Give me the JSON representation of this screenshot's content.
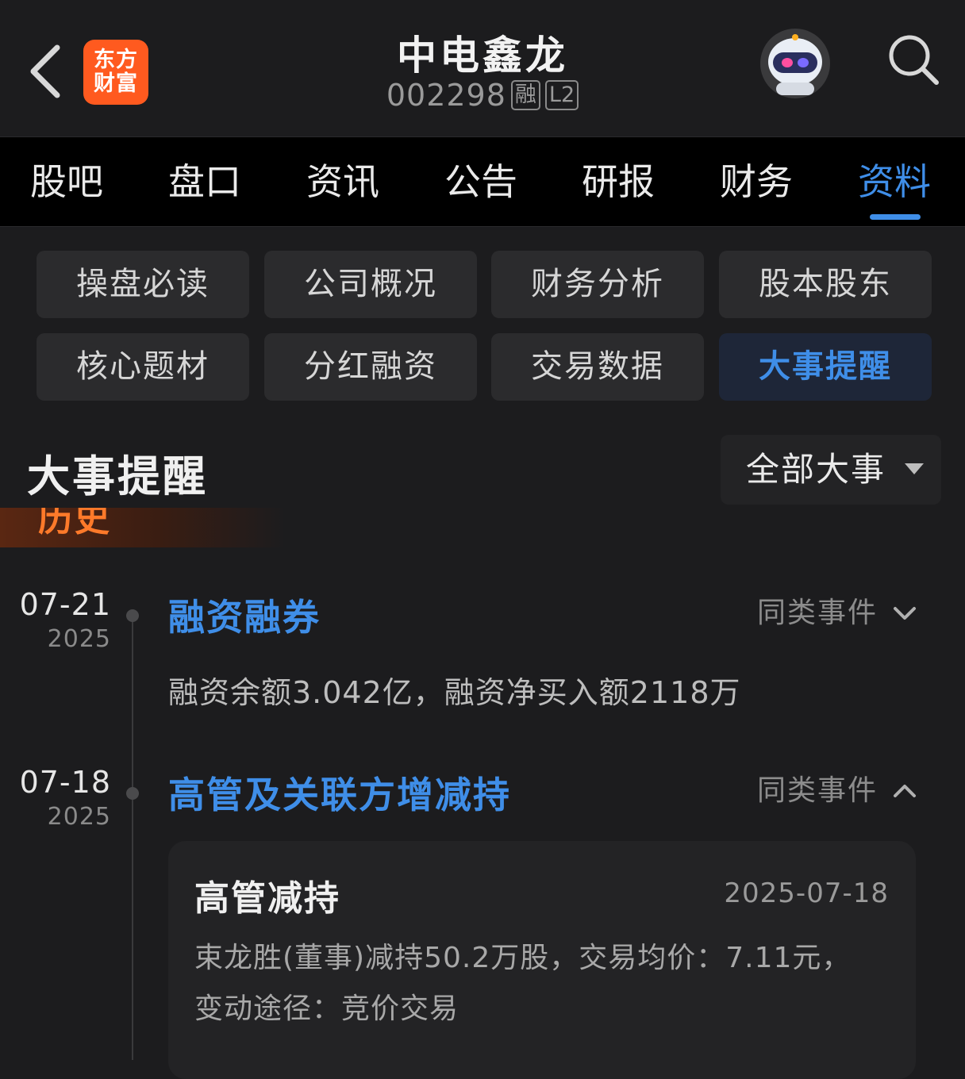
{
  "header": {
    "logo_line1": "东方",
    "logo_line2": "财富",
    "stock_name": "中电鑫龙",
    "stock_code": "002298",
    "badge_margin": "融",
    "badge_level": "L2"
  },
  "tabs": [
    {
      "label": "股吧"
    },
    {
      "label": "盘口"
    },
    {
      "label": "资讯"
    },
    {
      "label": "公告"
    },
    {
      "label": "研报"
    },
    {
      "label": "财务"
    },
    {
      "label": "资料",
      "active": true
    }
  ],
  "submenu": [
    {
      "label": "操盘必读"
    },
    {
      "label": "公司概况"
    },
    {
      "label": "财务分析"
    },
    {
      "label": "股本股东"
    },
    {
      "label": "核心题材"
    },
    {
      "label": "分红融资"
    },
    {
      "label": "交易数据"
    },
    {
      "label": "大事提醒",
      "active": true
    }
  ],
  "section": {
    "title": "大事提醒",
    "filter_label": "全部大事",
    "history_label": "历史"
  },
  "events": [
    {
      "date": "07-21",
      "year": "2025",
      "title": "融资融券",
      "similar_label": "同类事件",
      "desc": "融资余额3.042亿，融资净买入额2118万"
    },
    {
      "date": "07-18",
      "year": "2025",
      "title": "高管及关联方增减持",
      "similar_label": "同类事件",
      "card": {
        "title": "高管减持",
        "date": "2025-07-18",
        "body_line1": "束龙胜(董事)减持50.2万股，交易均价：7.11元，",
        "body_line2": "变动途径：竞价交易"
      }
    }
  ],
  "colors": {
    "accent": "#3f8ee8",
    "brand": "#ff5a1f",
    "background": "#1c1c1e",
    "history": "#ff7a2a"
  },
  "icons": {
    "back": "chevron-left-icon",
    "search": "search-icon",
    "assistant": "robot-avatar-icon",
    "expand": "chevron-down-icon",
    "collapse": "chevron-up-icon"
  }
}
